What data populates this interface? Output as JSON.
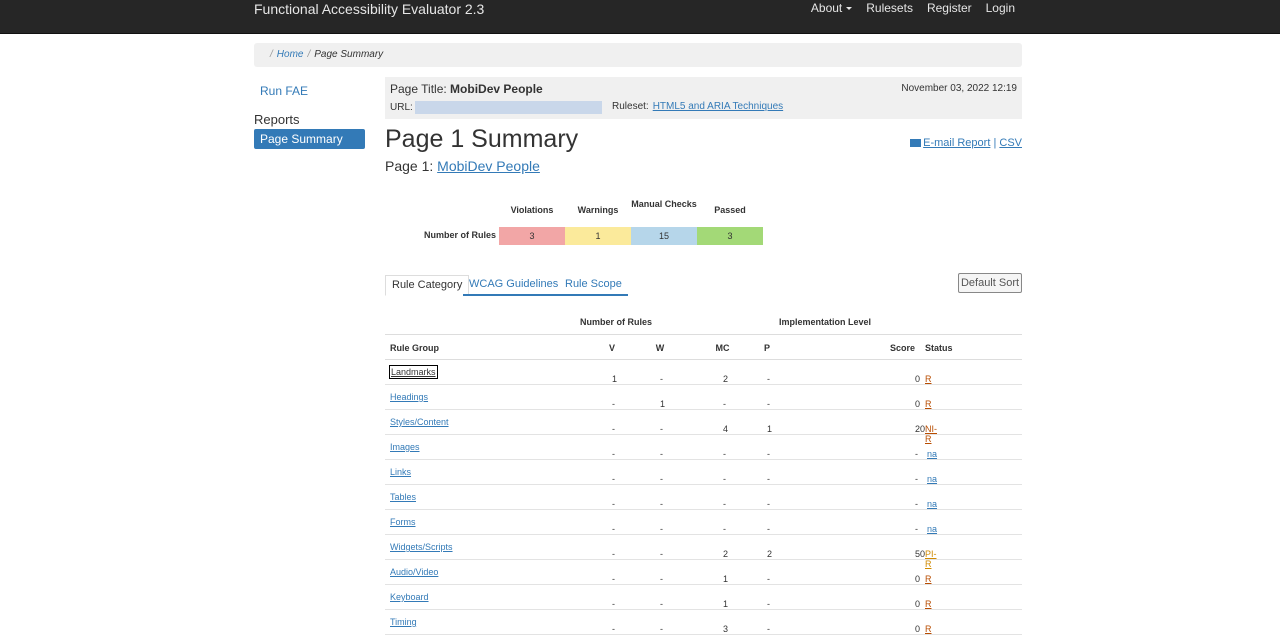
{
  "navbar": {
    "brand": "Functional Accessibility Evaluator 2.3",
    "items": [
      "About",
      "Rulesets",
      "Register",
      "Login"
    ]
  },
  "breadcrumb": {
    "home": "Home",
    "current": "Page Summary"
  },
  "sidebar": {
    "run_fae": "Run FAE",
    "reports_heading": "Reports",
    "page_summary": "Page Summary"
  },
  "page_header": {
    "title_label": "Page Title:",
    "title_value": "MobiDev People",
    "date": "November 03, 2022 12:19",
    "url_label": "URL:",
    "ruleset_label": "Ruleset:",
    "ruleset_value": "HTML5 and ARIA Techniques"
  },
  "heading": "Page 1 Summary",
  "subheading_label": "Page 1:",
  "subheading_link": "MobiDev People",
  "links": {
    "email": "E-mail Report",
    "sep": "|",
    "csv": "CSV"
  },
  "summary": {
    "row_label": "Number of Rules",
    "headers": [
      {
        "label": "Violations",
        "value": "3",
        "color": "#f2a6a6"
      },
      {
        "label": "Warnings",
        "value": "1",
        "color": "#fbea9b"
      },
      {
        "label": "Manual Checks",
        "value": "15",
        "color": "#b6d6ea"
      },
      {
        "label": "Passed",
        "value": "3",
        "color": "#a3d977"
      }
    ]
  },
  "tabs": [
    "Rule Category",
    "WCAG Guidelines",
    "Rule Scope"
  ],
  "sort_button": "Default Sort",
  "table": {
    "group_number": "Number of Rules",
    "group_impl": "Implementation Level",
    "headers": {
      "group": "Rule Group",
      "v": "V",
      "w": "W",
      "mc": "MC",
      "p": "P",
      "score": "Score",
      "status": "Status"
    },
    "rows": [
      {
        "name": "Landmarks",
        "v": "1",
        "w": "-",
        "mc": "2",
        "p": "-",
        "score": "0",
        "status": "R",
        "status_color": "#b84c00"
      },
      {
        "name": "Headings",
        "v": "-",
        "w": "1",
        "mc": "-",
        "p": "-",
        "score": "0",
        "status": "R",
        "status_color": "#b84c00"
      },
      {
        "name": "Styles/Content",
        "v": "-",
        "w": "-",
        "mc": "4",
        "p": "1",
        "score": "20",
        "status": "NI-R",
        "status_color": "#b84c00"
      },
      {
        "name": "Images",
        "v": "-",
        "w": "-",
        "mc": "-",
        "p": "-",
        "score": "-",
        "status": "na",
        "status_color": "#337ab7"
      },
      {
        "name": "Links",
        "v": "-",
        "w": "-",
        "mc": "-",
        "p": "-",
        "score": "-",
        "status": "na",
        "status_color": "#337ab7"
      },
      {
        "name": "Tables",
        "v": "-",
        "w": "-",
        "mc": "-",
        "p": "-",
        "score": "-",
        "status": "na",
        "status_color": "#337ab7"
      },
      {
        "name": "Forms",
        "v": "-",
        "w": "-",
        "mc": "-",
        "p": "-",
        "score": "-",
        "status": "na",
        "status_color": "#337ab7"
      },
      {
        "name": "Widgets/Scripts",
        "v": "-",
        "w": "-",
        "mc": "2",
        "p": "2",
        "score": "50",
        "status": "PI-R",
        "status_color": "#d08a00"
      },
      {
        "name": "Audio/Video",
        "v": "-",
        "w": "-",
        "mc": "1",
        "p": "-",
        "score": "0",
        "status": "R",
        "status_color": "#b84c00"
      },
      {
        "name": "Keyboard",
        "v": "-",
        "w": "-",
        "mc": "1",
        "p": "-",
        "score": "0",
        "status": "R",
        "status_color": "#b84c00"
      },
      {
        "name": "Timing",
        "v": "-",
        "w": "-",
        "mc": "3",
        "p": "-",
        "score": "0",
        "status": "R",
        "status_color": "#b84c00"
      }
    ]
  }
}
